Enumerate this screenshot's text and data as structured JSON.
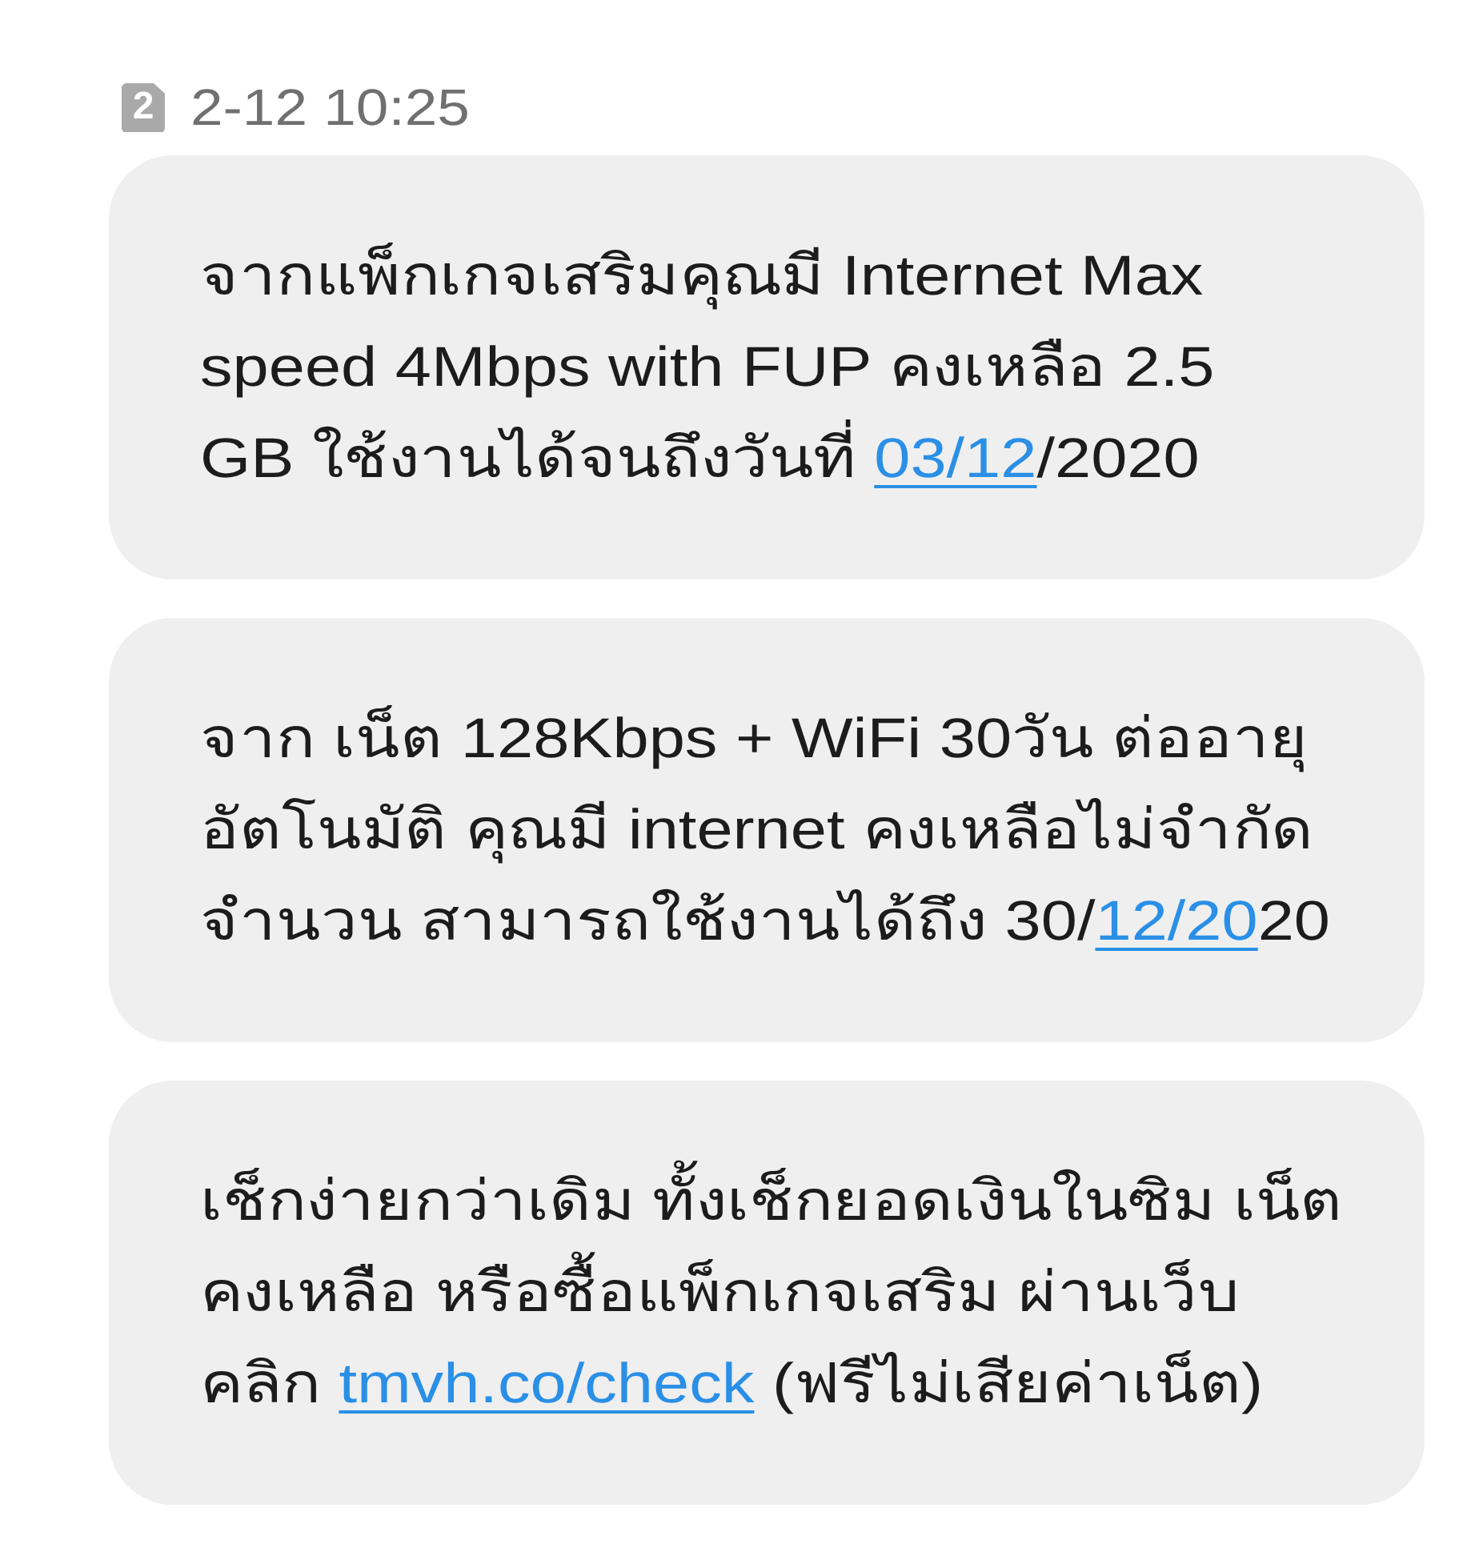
{
  "header": {
    "sim_slot": "2",
    "time": "2-12 10:25"
  },
  "messages": [
    {
      "segments": [
        {
          "kind": "text",
          "text": "จากแพ็กเกจเสริมคุณมี Internet Max\nspeed 4Mbps with FUP คงเหลือ 2.5\nGB ใช้งานได้จนถึงวันที่ "
        },
        {
          "kind": "link",
          "text": "03/12"
        },
        {
          "kind": "text",
          "text": "/2020"
        }
      ]
    },
    {
      "segments": [
        {
          "kind": "text",
          "text": "จาก เน็ต 128Kbps + WiFi 30วัน ต่ออายุ\nอัตโนมัติ คุณมี internet คงเหลือไม่จำกัด\nจำนวน สามารถใช้งานได้ถึง 30/"
        },
        {
          "kind": "link",
          "text": "12/20"
        },
        {
          "kind": "text",
          "text": "20"
        }
      ]
    },
    {
      "segments": [
        {
          "kind": "text",
          "text": "เช็กง่ายกว่าเดิม ทั้งเช็กยอดเงินในซิม เน็ต\nคงเหลือ หรือซื้อแพ็กเกจเสริม ผ่านเว็บ\nคลิก "
        },
        {
          "kind": "link",
          "text": "tmvh.co/check"
        },
        {
          "kind": "text",
          "text": " (ฟรีไม่เสียค่าเน็ต)"
        }
      ]
    }
  ]
}
